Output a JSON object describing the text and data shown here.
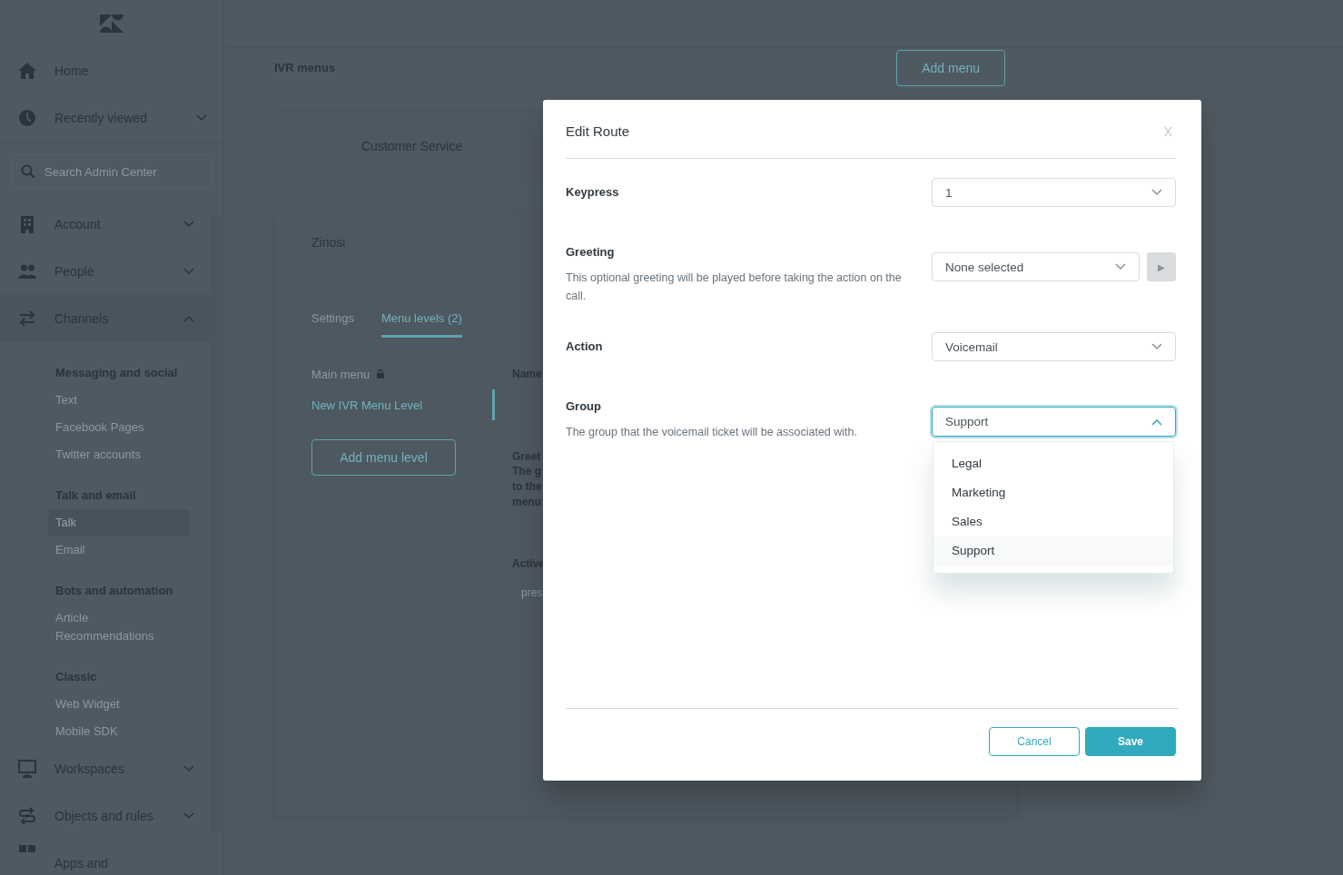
{
  "sidebar": {
    "top_items": [
      {
        "label": "Home"
      },
      {
        "label": "Recently viewed",
        "expanded": false
      }
    ],
    "search": {
      "placeholder": "Search Admin Center"
    },
    "sections": [
      {
        "label": "Account",
        "expanded": false
      },
      {
        "label": "People",
        "expanded": false
      },
      {
        "label": "Channels",
        "expanded": true,
        "groups": [
          {
            "heading": "Messaging and social",
            "items": [
              {
                "label": "Text",
                "selected": false
              },
              {
                "label": "Facebook Pages",
                "selected": false
              },
              {
                "label": "Twitter accounts",
                "selected": false
              }
            ]
          },
          {
            "heading": "Talk and email",
            "items": [
              {
                "label": "Talk",
                "selected": true
              },
              {
                "label": "Email",
                "selected": false
              }
            ]
          },
          {
            "heading": "Bots and automation",
            "items": [
              {
                "label": "Article Recommendations",
                "selected": false
              }
            ]
          },
          {
            "heading": "Classic",
            "items": [
              {
                "label": "Web Widget",
                "selected": false
              },
              {
                "label": "Mobile SDK",
                "selected": false
              }
            ]
          }
        ]
      },
      {
        "label": "Workspaces",
        "expanded": false
      },
      {
        "label": "Objects and rules",
        "expanded": false
      },
      {
        "label": "Apps and"
      }
    ]
  },
  "page": {
    "title": "IVR menus",
    "add_button": "Add menu",
    "ivr_card": {
      "name": "Customer Service"
    },
    "detail": {
      "title": "Zinosi",
      "tabs": [
        {
          "label": "Settings",
          "selected": false
        },
        {
          "label": "Menu levels (2)",
          "selected": true
        }
      ],
      "menu_levels": [
        {
          "label": "Main menu",
          "locked": true,
          "selected": false
        },
        {
          "label": "New IVR Menu Level",
          "locked": false,
          "selected": true
        }
      ],
      "add_level_button": "Add menu level",
      "form_fragments": [
        {
          "label": "Name"
        },
        {
          "label": "Greet",
          "lines": [
            "The g",
            "to the",
            "menu"
          ]
        },
        {
          "label": "Active",
          "value": "pres"
        }
      ]
    }
  },
  "dialog": {
    "title": "Edit Route",
    "close": "X",
    "fields": [
      {
        "label": "Keypress",
        "value": "1",
        "open": false
      },
      {
        "label": "Greeting",
        "description": "This optional greeting will be played before taking the action on the call.",
        "value": "None selected",
        "open": false,
        "play_button": {
          "symbol": "▶",
          "disabled": true
        }
      },
      {
        "label": "Action",
        "value": "Voicemail",
        "open": false
      },
      {
        "label": "Group",
        "description": "The group that the voicemail ticket will be associated with.",
        "value": "Support",
        "open": true,
        "options": [
          {
            "label": "Legal",
            "selected": false
          },
          {
            "label": "Marketing",
            "selected": false
          },
          {
            "label": "Sales",
            "selected": false
          },
          {
            "label": "Support",
            "selected": true
          }
        ]
      }
    ],
    "buttons": [
      {
        "label": "Cancel",
        "kind": "secondary"
      },
      {
        "label": "Save",
        "kind": "primary"
      }
    ]
  }
}
